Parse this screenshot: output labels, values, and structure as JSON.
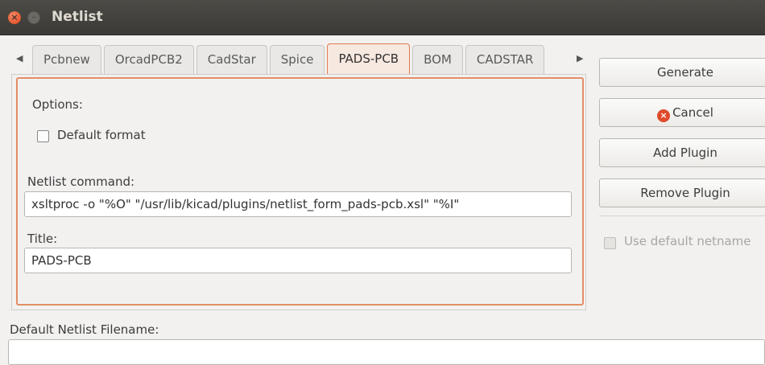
{
  "window": {
    "title": "Netlist"
  },
  "tabs": [
    {
      "label": "Pcbnew",
      "active": false
    },
    {
      "label": "OrcadPCB2",
      "active": false
    },
    {
      "label": "CadStar",
      "active": false
    },
    {
      "label": "Spice",
      "active": false
    },
    {
      "label": "PADS-PCB",
      "active": true
    },
    {
      "label": "BOM",
      "active": false
    },
    {
      "label": "CADSTAR",
      "active": false
    }
  ],
  "panel": {
    "options_label": "Options:",
    "default_format_label": "Default format",
    "default_format_checked": false,
    "netlist_command_label": "Netlist command:",
    "netlist_command_value": "xsltproc -o \"%O\" \"/usr/lib/kicad/plugins/netlist_form_pads-pcb.xsl\" \"%I\"",
    "title_label": "Title:",
    "title_value": "PADS-PCB"
  },
  "buttons": {
    "generate": "Generate",
    "cancel": "Cancel",
    "add_plugin": "Add Plugin",
    "remove_plugin": "Remove Plugin"
  },
  "use_default_netname": {
    "label": "Use default netname",
    "checked": false,
    "enabled": false
  },
  "filename": {
    "label": "Default Netlist Filename:",
    "value": ""
  },
  "colors": {
    "accent": "#e48d66",
    "titlebar": "#3f3e3a",
    "close": "#e2562f"
  }
}
